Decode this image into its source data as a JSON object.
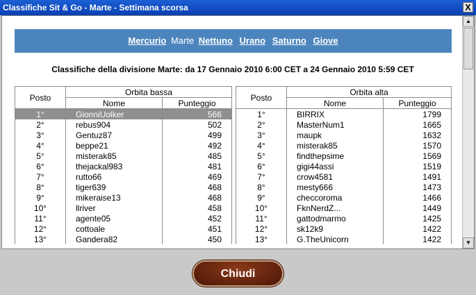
{
  "window": {
    "title": "Classifiche Sit & Go - Marte - Settimana scorsa",
    "close_glyph": "X"
  },
  "nav": {
    "items": [
      {
        "label": "Mercurio",
        "current": false
      },
      {
        "label": "Marte",
        "current": true
      },
      {
        "label": "Nettuno",
        "current": false
      },
      {
        "label": "Urano",
        "current": false
      },
      {
        "label": "Saturno",
        "current": false
      },
      {
        "label": "Giove",
        "current": false
      }
    ]
  },
  "heading": "Classifiche della divisione Marte: da 17 Gennaio 2010 6:00 CET a 24 Gennaio 2010 5:59 CET",
  "tables": {
    "headers": {
      "posto": "Posto",
      "nome": "Nome",
      "punteggio": "Punteggio"
    },
    "left": {
      "group": "Orbita bassa",
      "rows": [
        {
          "pos": "1°",
          "nome": "GionniUolker",
          "punt": "566",
          "highlight": true
        },
        {
          "pos": "2°",
          "nome": "rebus904",
          "punt": "502"
        },
        {
          "pos": "3°",
          "nome": "Gentuz87",
          "punt": "499"
        },
        {
          "pos": "4°",
          "nome": "beppe21",
          "punt": "492"
        },
        {
          "pos": "5°",
          "nome": "misterak85",
          "punt": "485"
        },
        {
          "pos": "6°",
          "nome": "thejackal983",
          "punt": "481"
        },
        {
          "pos": "7°",
          "nome": "rutto66",
          "punt": "469"
        },
        {
          "pos": "8°",
          "nome": "tiger639",
          "punt": "468"
        },
        {
          "pos": "9°",
          "nome": "mikeraise13",
          "punt": "468"
        },
        {
          "pos": "10°",
          "nome": "llriver",
          "punt": "458"
        },
        {
          "pos": "11°",
          "nome": "agente05",
          "punt": "452"
        },
        {
          "pos": "12°",
          "nome": "cottoale",
          "punt": "451"
        },
        {
          "pos": "13°",
          "nome": "Gandera82",
          "punt": "450"
        }
      ]
    },
    "right": {
      "group": "Orbita alta",
      "rows": [
        {
          "pos": "1°",
          "nome": "BIRRIX",
          "punt": "1799"
        },
        {
          "pos": "2°",
          "nome": "MasterNum1",
          "punt": "1665"
        },
        {
          "pos": "3°",
          "nome": "maupk",
          "punt": "1632"
        },
        {
          "pos": "4°",
          "nome": "misterak85",
          "punt": "1570"
        },
        {
          "pos": "5°",
          "nome": "findthepsime",
          "punt": "1569"
        },
        {
          "pos": "6°",
          "nome": "gigi44assi",
          "punt": "1519"
        },
        {
          "pos": "7°",
          "nome": "crow4581",
          "punt": "1491"
        },
        {
          "pos": "8°",
          "nome": "mesty666",
          "punt": "1473"
        },
        {
          "pos": "9°",
          "nome": "checcoroma",
          "punt": "1466"
        },
        {
          "pos": "10°",
          "nome": "FknNerdZ...",
          "punt": "1449"
        },
        {
          "pos": "11°",
          "nome": "gattodmarmo",
          "punt": "1425"
        },
        {
          "pos": "12°",
          "nome": "sk12k9",
          "punt": "1422"
        },
        {
          "pos": "13°",
          "nome": "G.TheUnicorn",
          "punt": "1422"
        }
      ]
    }
  },
  "scroll": {
    "up_glyph": "▲",
    "down_glyph": "▼"
  },
  "footer": {
    "close_label": "Chiudi"
  },
  "colors": {
    "nav_bg": "#4c85bd",
    "highlight_row": "#8f8f8f",
    "button_bg": "#6a2610"
  }
}
